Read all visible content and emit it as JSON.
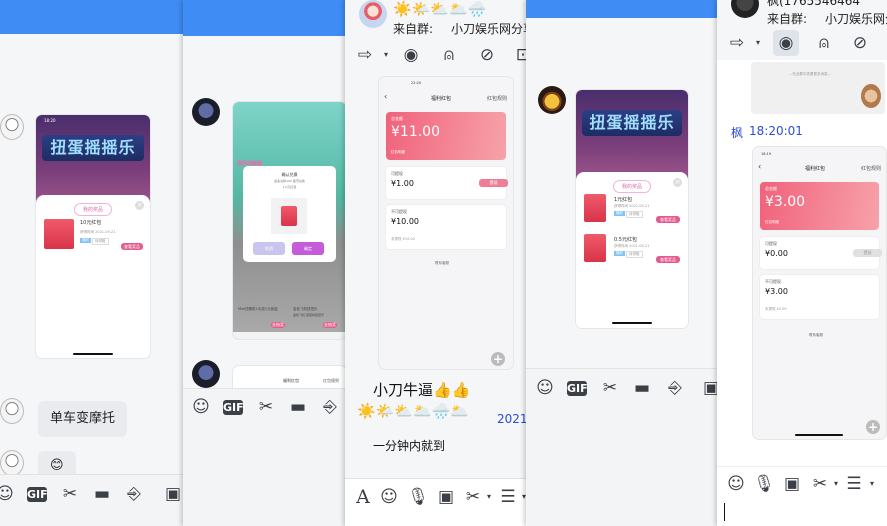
{
  "panel1": {
    "bubble1": "单车变摩托",
    "bubble2": "😊",
    "phone": {
      "status_time": "18:20",
      "game_title": "扭蛋摇摇乐",
      "sheet_title": "我的奖品",
      "item_name": "10元红包",
      "item_date": "获得时间 2021-09-21",
      "tag1": "福利",
      "tag2": "待领取",
      "btn": "查看奖品"
    },
    "toolbar": {
      "gif": "GIF"
    }
  },
  "panel2": {
    "phone": {
      "banner": "摇你的超值",
      "dialog_title": "确认兑换",
      "dialog_line1": "最多兑换100 星币兑换",
      "dialog_line2": "1.0元红包",
      "cancel": "取消",
      "confirm": "确定",
      "caption_left": "Mini扭蛋机1毛钱1元盲盒",
      "caption_right": "金色飞机扭扭乐",
      "caption_right2": "金色飞机 扭蛋机扭扭乐",
      "btn_left": "去抽奖",
      "btn_right": "去抽奖"
    },
    "mini": {
      "title": "福利红包",
      "rule": "红包规则"
    },
    "toolbar": {
      "gif": "GIF"
    }
  },
  "panel3": {
    "header": {
      "weather": "☀️🌤️⛅🌥️🌧️",
      "from_label": "来自群:",
      "group_name": "小刀娱乐网分享"
    },
    "phone": {
      "status": "22:20",
      "title": "福利红包",
      "rule": "红包规则",
      "total_label": "总金额",
      "total": "¥11.00",
      "withdraw_label": "红包明细",
      "available_label": "可提现",
      "available": "¥1.00",
      "withdraw_btn": "提现",
      "unavailable_label": "不可提现",
      "unavailable": "¥10.00",
      "unavailable_note": "未提现 ¥10.00",
      "contact": "联系客服"
    },
    "msg1": "小刀牛逼👍👍",
    "msg_weather": "☀️🌤️⛅🌥️🌧️🌥️",
    "msg_date": "2021",
    "msg2": "一分钟内就到"
  },
  "panel4": {
    "phone": {
      "game_title": "扭蛋摇摇乐",
      "sheet_title": "我的奖品",
      "item1_name": "1元红包",
      "item1_date": "获得时间 2021-09-21",
      "item2_name": "0.5元红包",
      "item2_date": "获得时间 2021-09-21",
      "tag1": "福利",
      "tag2": "待领取",
      "btn": "查看奖品"
    },
    "toolbar": {
      "gif": "GIF"
    }
  },
  "panel5": {
    "header": {
      "name_partial": "枫(1765546464",
      "from_label": "来自群:",
      "group_name": "小刀娱乐网分享"
    },
    "screenshot_note": "—在此群中查看更多消息—",
    "sender": "枫",
    "time": "18:20:01",
    "phone": {
      "status": "18:19",
      "title": "福利红包",
      "rule": "红包规则",
      "total_label": "总金额",
      "total": "¥3.00",
      "withdraw_label": "红包明细",
      "available_label": "可提现",
      "available": "¥0.00",
      "withdraw_btn": "提现",
      "unavailable_label": "不可提现",
      "unavailable": "¥3.00",
      "unavailable_note": "未提现 ¥3.00",
      "contact": "联系客服"
    }
  }
}
